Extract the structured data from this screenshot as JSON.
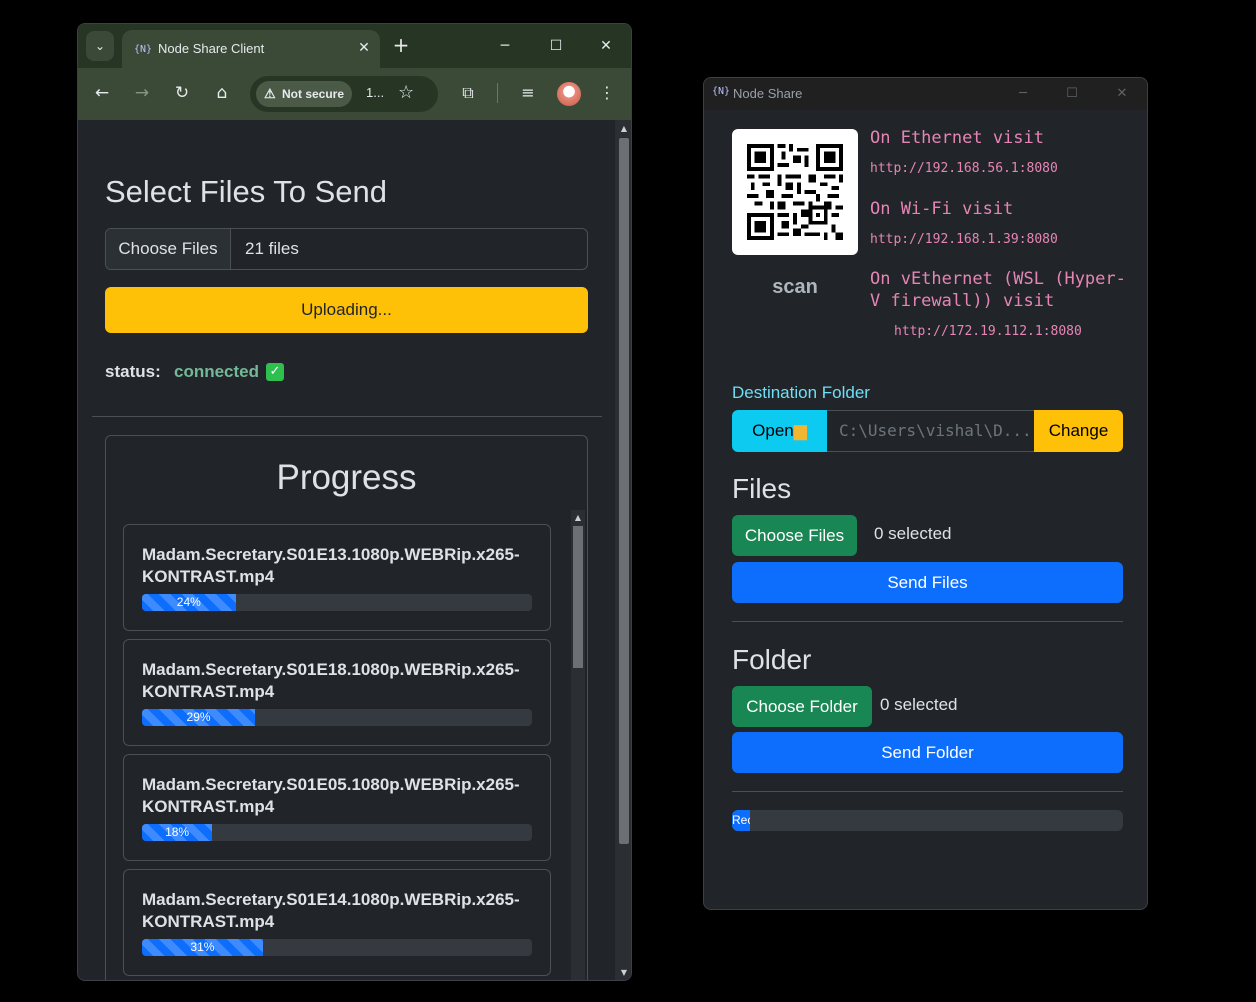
{
  "browser": {
    "tab_title": "Node Share Client",
    "tab_favicon": "node-share-icon",
    "security_label": "Not secure",
    "url_text": "1...",
    "page": {
      "title": "Select Files To Send",
      "choose_files_label": "Choose Files",
      "files_value": "21 files",
      "upload_button": "Uploading...",
      "status_label": "status:",
      "status_value": "connected",
      "progress_title": "Progress",
      "files": [
        {
          "name": "Madam.Secretary.S01E13.1080p.WEBRip.x265-KONTRAST.mp4",
          "progress": 24,
          "progress_label": "24%"
        },
        {
          "name": "Madam.Secretary.S01E18.1080p.WEBRip.x265-KONTRAST.mp4",
          "progress": 29,
          "progress_label": "29%"
        },
        {
          "name": "Madam.Secretary.S01E05.1080p.WEBRip.x265-KONTRAST.mp4",
          "progress": 18,
          "progress_label": "18%"
        },
        {
          "name": "Madam.Secretary.S01E14.1080p.WEBRip.x265-KONTRAST.mp4",
          "progress": 31,
          "progress_label": "31%"
        }
      ]
    }
  },
  "app": {
    "title": "Node Share",
    "scan_label": "scan",
    "networks": [
      {
        "label": "On Ethernet visit",
        "url": "http://192.168.56.1:8080"
      },
      {
        "label": "On Wi-Fi visit",
        "url": "http://192.168.1.39:8080"
      },
      {
        "label": "On vEthernet (WSL (Hyper-V firewall)) visit",
        "label_line1": "On vEthernet (WSL (Hyper-",
        "label_line2": "V firewall)) visit",
        "url": "http://172.19.112.1:8080"
      }
    ],
    "destination_label": "Destination Folder",
    "open_button": "Open",
    "path_value": "C:\\Users\\vishal\\D...",
    "change_button": "Change",
    "files_heading": "Files",
    "choose_files_button": "Choose Files",
    "files_selected": "0 selected",
    "send_files_button": "Send Files",
    "folder_heading": "Folder",
    "choose_folder_button": "Choose Folder",
    "folder_selected": "0 selected",
    "send_folder_button": "Send Folder",
    "bottom_progress": 4.5,
    "bottom_progress_label": "Rec"
  },
  "colors": {
    "warning": "#ffc107",
    "primary": "#0d6efd",
    "success": "#198754",
    "info": "#0dcaf0",
    "status_connected": "#75b798",
    "network_text": "#e685b5"
  }
}
